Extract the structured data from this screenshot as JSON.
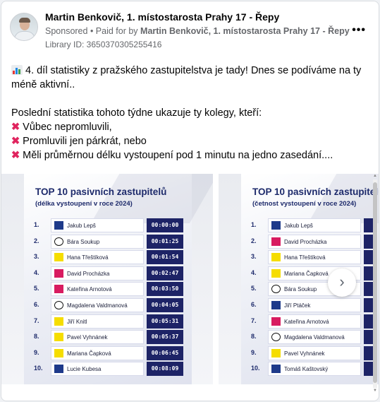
{
  "post": {
    "page_name": "Martin Benkovič, 1. místostarosta Prahy 17 - Řepy",
    "sponsored": "Sponsored",
    "separator": " • ",
    "paid_for_prefix": "Paid for by ",
    "paid_for_by": "Martin Benkovič, 1. místostarosta Prahy 17 - Řepy",
    "library_id": "Library ID: 3650370305255416",
    "more_icon": "more-horizontal-icon"
  },
  "body": {
    "line1": "4. díl statistiky z pražského zastupitelstva je tady! Dnes se podíváme na ty",
    "line2": "méně aktivní..",
    "line3": "Poslední statistika tohoto týdne ukazuje ty kolegy, kteří:",
    "bullets": [
      "Vůbec nepromluvili,",
      "Promluvili jen párkrát, nebo",
      "Měli průměrnou délku vystoupení pod 1 minutu na jedno zasedání...."
    ]
  },
  "slides": [
    {
      "title": "TOP 10 pasivních zastupitelů",
      "subtitle": "(délka vystoupení v roce 2024)",
      "rows": [
        {
          "rank": "1.",
          "party": "ods",
          "name": "Jakub Lepš",
          "value": "00:00:00"
        },
        {
          "rank": "2.",
          "party": "pir",
          "name": "Bára Soukup",
          "value": "00:01:25"
        },
        {
          "rank": "3.",
          "party": "stan",
          "name": "Hana Třeštíková",
          "value": "00:01:54"
        },
        {
          "rank": "4.",
          "party": "top",
          "name": "David Procházka",
          "value": "00:02:47"
        },
        {
          "rank": "5.",
          "party": "top",
          "name": "Kateřina Arnotová",
          "value": "00:03:50"
        },
        {
          "rank": "6.",
          "party": "pir",
          "name": "Magdalena Valdmanová",
          "value": "00:04:05"
        },
        {
          "rank": "7.",
          "party": "stan",
          "name": "Jiří Knitl",
          "value": "00:05:31"
        },
        {
          "rank": "8.",
          "party": "stan",
          "name": "Pavel Vyhnánek",
          "value": "00:05:37"
        },
        {
          "rank": "9.",
          "party": "stan",
          "name": "Mariana Čapková",
          "value": "00:06:45"
        },
        {
          "rank": "10.",
          "party": "ods",
          "name": "Lucie Kubesa",
          "value": "00:08:09"
        }
      ]
    },
    {
      "title": "TOP 10 pasivních zastupitelů",
      "subtitle": "(četnost vystoupení v roce 2024)",
      "rows": [
        {
          "rank": "1.",
          "party": "ods",
          "name": "Jakub Lepš",
          "value": ""
        },
        {
          "rank": "2.",
          "party": "top",
          "name": "David Procházka",
          "value": ""
        },
        {
          "rank": "3.",
          "party": "stan",
          "name": "Hana Třeštíková",
          "value": ""
        },
        {
          "rank": "4.",
          "party": "stan",
          "name": "Mariana Čapková",
          "value": ""
        },
        {
          "rank": "5.",
          "party": "pir",
          "name": "Bára Soukup",
          "value": ""
        },
        {
          "rank": "6.",
          "party": "ods",
          "name": "Jiří Ptáček",
          "value": ""
        },
        {
          "rank": "7.",
          "party": "top",
          "name": "Kateřina Arnotová",
          "value": ""
        },
        {
          "rank": "8.",
          "party": "pir",
          "name": "Magdalena Valdmanová",
          "value": ""
        },
        {
          "rank": "9.",
          "party": "stan",
          "name": "Pavel Vyhnánek",
          "value": ""
        },
        {
          "rank": "10.",
          "party": "ods",
          "name": "Tomáš Kaštovský",
          "value": ""
        }
      ]
    }
  ],
  "carousel": {
    "next_icon": "chevron-right-icon"
  }
}
